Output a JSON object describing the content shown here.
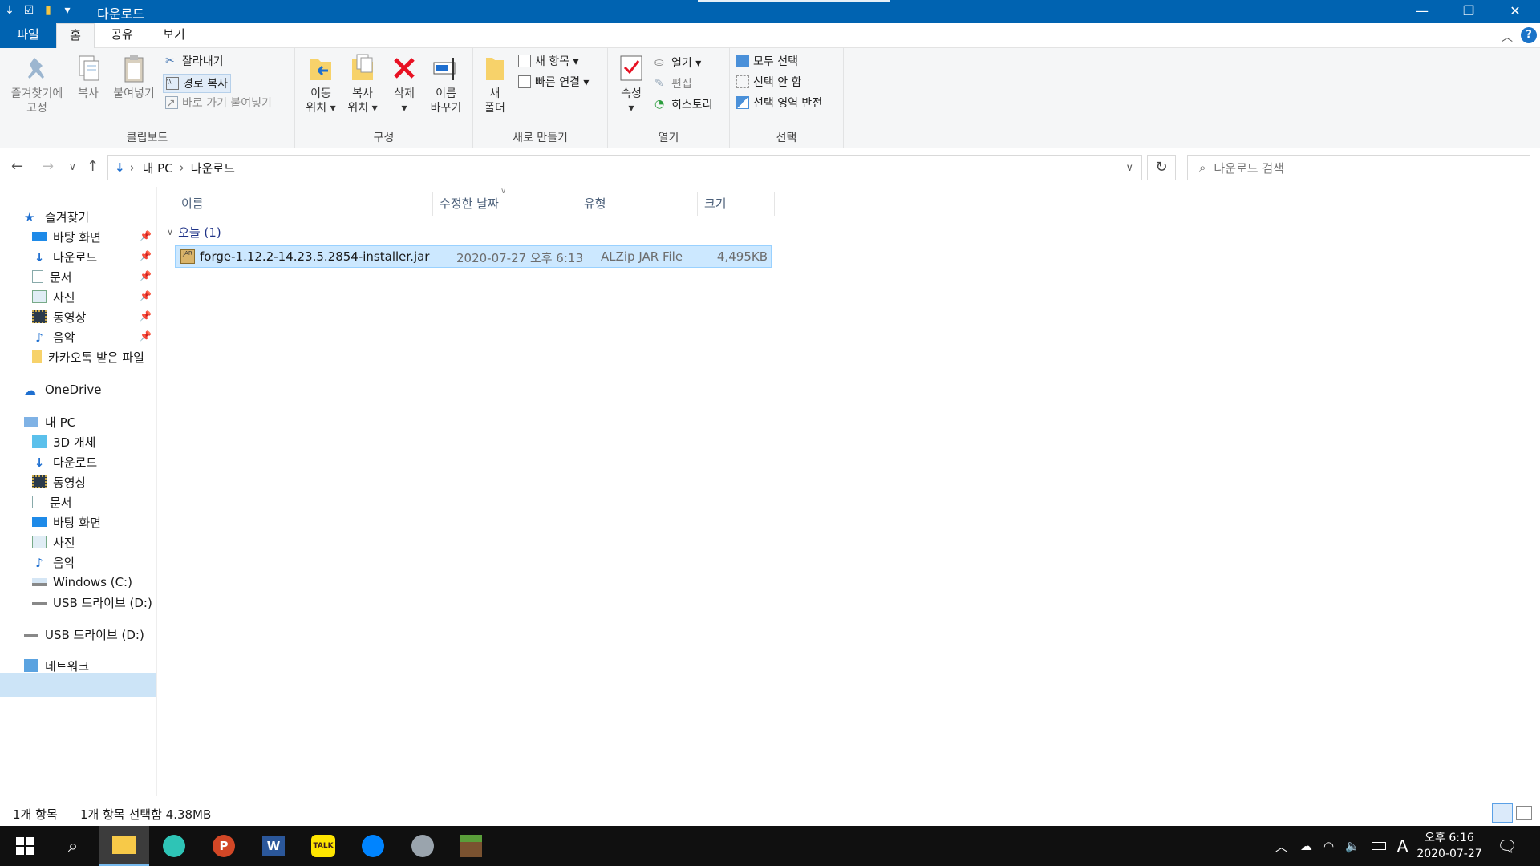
{
  "window": {
    "title": "다운로드",
    "quick_access": [
      "↓",
      "☑",
      "▮",
      "▾"
    ],
    "controls": [
      "—",
      "❐",
      "✕"
    ]
  },
  "tabs": {
    "file": "파일",
    "home": "홈",
    "share": "공유",
    "view": "보기"
  },
  "ribbon": {
    "clipboard": {
      "label": "클립보드",
      "pin": "즐겨찾기에\n고정",
      "copy": "복사",
      "paste": "붙여넣기",
      "cut": "잘라내기",
      "copy_path": "경로 복사",
      "paste_shortcut": "바로 가기 붙여넣기"
    },
    "organize": {
      "label": "구성",
      "move_to": "이동\n위치 ▾",
      "copy_to": "복사\n위치 ▾",
      "delete": "삭제\n▾",
      "rename": "이름\n바꾸기"
    },
    "new": {
      "label": "새로 만들기",
      "new_folder": "새\n폴더",
      "new_item": "새 항목 ▾",
      "easy_access": "빠른 연결 ▾"
    },
    "open": {
      "label": "열기",
      "properties": "속성\n▾",
      "open": "열기 ▾",
      "edit": "편집",
      "history": "히스토리"
    },
    "select": {
      "label": "선택",
      "select_all": "모두 선택",
      "select_none": "선택 안 함",
      "invert": "선택 영역 반전"
    }
  },
  "address": {
    "crumbs": [
      "내 PC",
      "다운로드"
    ],
    "search_placeholder": "다운로드 검색"
  },
  "nav": {
    "quick_access": "즐겨찾기",
    "quick_items": [
      "바탕 화면",
      "다운로드",
      "문서",
      "사진",
      "동영상",
      "음악",
      "카카오톡 받은 파일"
    ],
    "onedrive": "OneDrive",
    "this_pc": "내 PC",
    "pc_items": [
      "3D 개체",
      "다운로드",
      "동영상",
      "문서",
      "바탕 화면",
      "사진",
      "음악",
      "Windows (C:)",
      "USB 드라이브 (D:)"
    ],
    "usb": "USB 드라이브 (D:)",
    "network": "네트워크"
  },
  "columns": {
    "name": "이름",
    "date": "수정한 날짜",
    "type": "유형",
    "size": "크기"
  },
  "group": {
    "label": "오늘 (1)"
  },
  "files": [
    {
      "name": "forge-1.12.2-14.23.5.2854-installer.jar",
      "date": "2020-07-27 오후 6:13",
      "type": "ALZip JAR File",
      "size": "4,495KB"
    }
  ],
  "status": {
    "count": "1개 항목",
    "selected": "1개 항목 선택함 4.38MB"
  },
  "taskbar": {
    "time": "오후 6:16",
    "date": "2020-07-27",
    "ime": "A"
  }
}
